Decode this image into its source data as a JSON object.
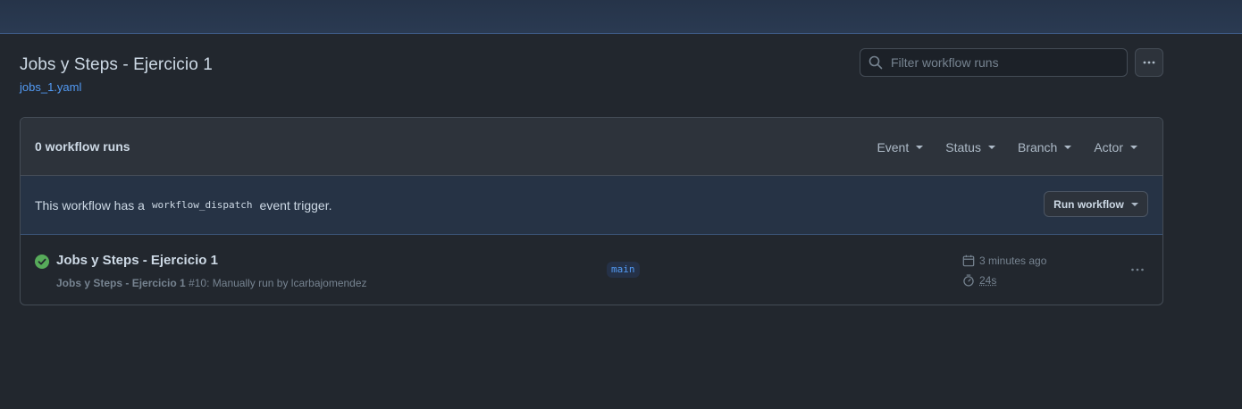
{
  "header": {
    "title": "Jobs y Steps - Ejercicio 1",
    "file_link": "jobs_1.yaml"
  },
  "search": {
    "placeholder": "Filter workflow runs",
    "value": ""
  },
  "runs": {
    "count_label": "0 workflow runs",
    "filters": [
      {
        "label": "Event"
      },
      {
        "label": "Status"
      },
      {
        "label": "Branch"
      },
      {
        "label": "Actor"
      }
    ]
  },
  "dispatch": {
    "prefix": "This workflow has a",
    "code": "workflow_dispatch",
    "suffix": "event trigger.",
    "button_label": "Run workflow"
  },
  "run_item": {
    "title": "Jobs y Steps - Ejercicio 1",
    "meta_workflow": "Jobs y Steps - Ejercicio 1",
    "meta_detail": "#10: Manually run by lcarbajomendez",
    "branch": "main",
    "time_ago": "3 minutes ago",
    "duration": "24s",
    "status": "success"
  },
  "icons": {
    "search": "search-icon",
    "more": "kebab-horizontal-icon",
    "status": "check-circle-fill-icon",
    "calendar": "calendar-icon",
    "stopwatch": "stopwatch-icon"
  },
  "colors": {
    "background": "#22272e",
    "topbar": "#2a3a52",
    "link": "#539bf5",
    "success": "#57ab5a",
    "dispatch_bar": "#263345"
  }
}
